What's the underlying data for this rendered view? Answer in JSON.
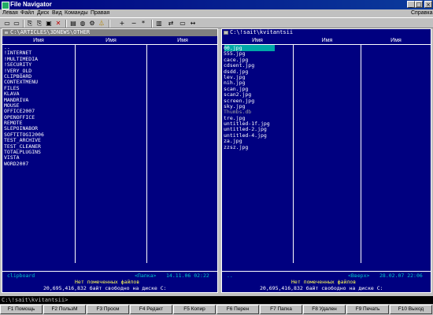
{
  "window": {
    "title": "File Navigator",
    "buttons": {
      "minimize": "_",
      "maximize": "□",
      "close": "×"
    }
  },
  "menu": {
    "items": [
      "Левая",
      "Файл",
      "Диск",
      "Вид",
      "Команды",
      "Правая"
    ],
    "help": "Справка"
  },
  "toolbar": {
    "icons": [
      "drive-icon",
      "network-icon",
      "copy-icon",
      "move-icon",
      "newfolder-icon",
      "delete-icon",
      "properties-icon",
      "find-icon",
      "settings-icon",
      "filter-icon",
      "add-icon",
      "minus-icon",
      "star-icon",
      "compare-icon",
      "sync-icon",
      "terminal-icon",
      "swap-icon"
    ],
    "glyphs": [
      "▭",
      "▭",
      "⎘",
      "⎘",
      "▣",
      "✕",
      "▤",
      "◍",
      "⚙",
      "⏃",
      "+",
      "−",
      "*",
      "▥",
      "⇄",
      "▭",
      "↔"
    ]
  },
  "left_panel": {
    "path": "C:\\ARTICLES\\3DNEWS\\OTHER",
    "column_header": "Имя",
    "files": [
      "..",
      "!INTERNET",
      "!MULTIMEDIA",
      "!SECURITY",
      "!VERY_OLD",
      "CLIPBOARD",
      "CONTEXTMENU",
      "FILES",
      "KLAVA",
      "MANDRIVA",
      "MOUSE",
      "OFFICE2007",
      "OPENOFFICE",
      "REMOTE",
      "SLEPOINABOR",
      "SOFTITOGI2006",
      "TEST_ARCHIVE",
      "TEST_CLEANER",
      "TOTALPLUGINS",
      "VISTA",
      "WORD2007"
    ],
    "info_name": "clipboard",
    "info_type": "<Папка>",
    "info_date": "14.11.06 02:22",
    "selection_status": "Нет помеченных файлов",
    "free_space": "20,695,416,832 байт свободно на диске C:"
  },
  "right_panel": {
    "path": "C:\\!sait\\kvitantsii",
    "column_header": "Имя",
    "files": [
      "00.jpg",
      "555.jpg",
      "cace.jpg",
      "cdsent.jpg",
      "dsdd.jpg",
      "lev.jpg",
      "nih.jpg",
      "scan.jpg",
      "scan2.jpg",
      "screen.jpg",
      "sky.jpg",
      "Thumbs.db",
      "tre.jpg",
      "untitled-1f.jpg",
      "untitled-2.jpg",
      "untitled-4.jpg",
      "za.jpg",
      "zzsz.jpg"
    ],
    "hidden_file_color": "#a0a0a0",
    "info_name": "..",
    "info_type": "<Вверх>",
    "info_date": "28.02.07 22:06",
    "selection_status": "Нет помеченных файлов",
    "free_space": "20,695,416,832 байт свободно на диске C:"
  },
  "command_line": "C:\\!sait\\kvitantsii>",
  "function_keys": [
    {
      "key": "F1",
      "label": "F1 Помощь"
    },
    {
      "key": "F2",
      "label": "F2 ПользМ"
    },
    {
      "key": "F3",
      "label": "F3 Просм"
    },
    {
      "key": "F4",
      "label": "F4 Редакт"
    },
    {
      "key": "F5",
      "label": "F5 Копир"
    },
    {
      "key": "F6",
      "label": "F6 Перен"
    },
    {
      "key": "F7",
      "label": "F7 Папка"
    },
    {
      "key": "F8",
      "label": "F8 Удален"
    },
    {
      "key": "F9",
      "label": "F9 Печать"
    },
    {
      "key": "F10",
      "label": "F10 Выход"
    }
  ],
  "colors": {
    "panel_bg": "#000080",
    "cursor": "#00a8a8",
    "highlight_text": "#ffff55",
    "info_text": "#00c8c8"
  }
}
